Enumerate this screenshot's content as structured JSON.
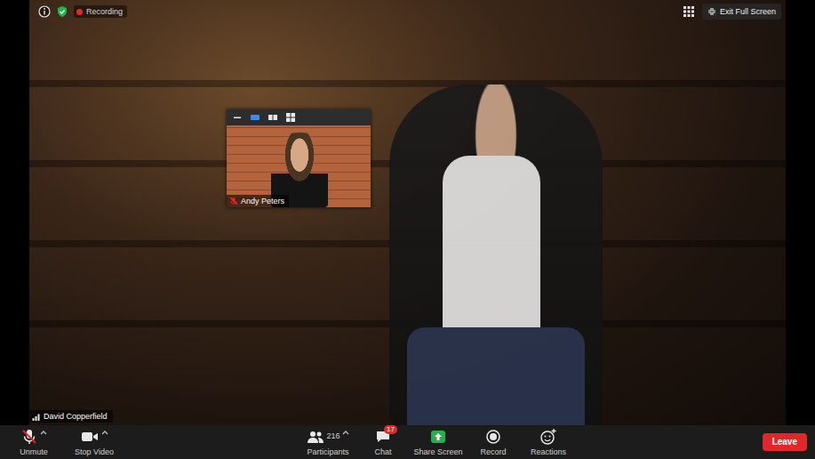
{
  "recording": {
    "label": "Recording",
    "on": true
  },
  "exit_button": {
    "label": "Exit Full Screen"
  },
  "main_video": {
    "participant": "David Copperfield"
  },
  "thumbnail": {
    "participant": "Andy Peters",
    "muted": true
  },
  "toolbar": {
    "items": [
      {
        "kind": "mic",
        "label": "Unmute",
        "muted": true,
        "menu": true
      },
      {
        "kind": "video",
        "label": "Stop Video",
        "menu": true
      },
      {
        "kind": "participants",
        "label": "Participants",
        "count": "216",
        "menu": true
      },
      {
        "kind": "chat",
        "label": "Chat",
        "badge": "17"
      },
      {
        "kind": "share",
        "label": "Share Screen"
      },
      {
        "kind": "record",
        "label": "Record"
      },
      {
        "kind": "reactions",
        "label": "Reactions"
      }
    ],
    "leave": "Leave"
  }
}
